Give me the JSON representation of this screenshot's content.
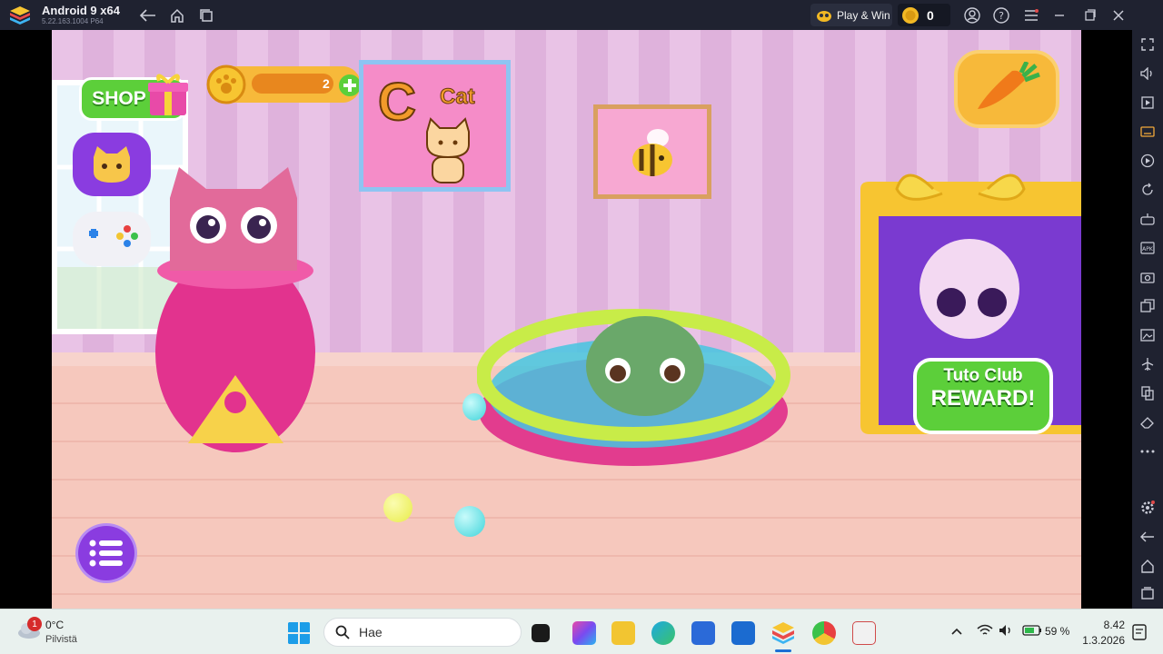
{
  "emulator": {
    "title": "Android 9 x64",
    "version": "5.22.163.1004  P64",
    "play_win_label": "Play & Win",
    "coin_count": "0"
  },
  "game": {
    "shop_label": "SHOP",
    "paw_counter": "2",
    "poster_letter": "C",
    "poster_word": "Cat",
    "reward_line1": "Tuto Club",
    "reward_line2": "REWARD!"
  },
  "taskbar": {
    "weather_temp": "0°C",
    "weather_desc": "Pilvistä",
    "weather_badge": "1",
    "search_placeholder": "Hae",
    "battery": "59 %",
    "time": "8.42",
    "date": "1.3.2026"
  },
  "icons": [
    "back-arrow-icon",
    "home-icon",
    "recents-icon",
    "account-icon",
    "help-icon",
    "menu-icon",
    "minimize-icon",
    "maximize-icon",
    "close-icon",
    "fullscreen-icon",
    "volume-icon",
    "wifi-icon",
    "battery-icon",
    "windows-start-icon",
    "search-icon"
  ],
  "colors": {
    "topbar": "#1f2230",
    "shop_green": "#5ccf3a",
    "purple_button": "#8a3ce0",
    "accent_orange": "#f29b2a"
  }
}
